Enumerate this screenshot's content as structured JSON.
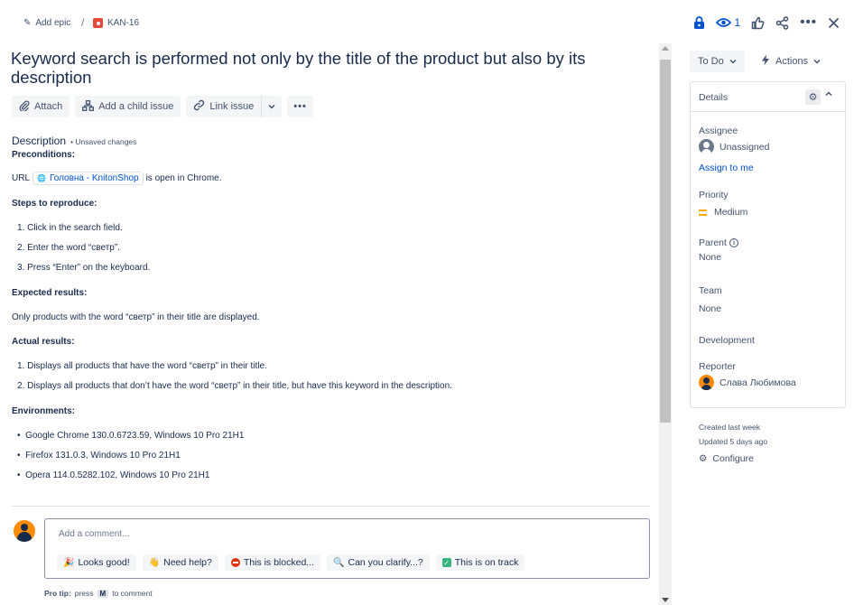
{
  "breadcrumb": {
    "epic_label": "Add epic",
    "separator": "/",
    "issue_key": "KAN-16"
  },
  "header": {
    "watch_count": "1"
  },
  "issue": {
    "title": "Keyword search is performed not only by the title of the product but also by its description"
  },
  "toolbar": {
    "attach": "Attach",
    "child": "Add a child issue",
    "link": "Link issue"
  },
  "description": {
    "heading": "Description",
    "unsaved": "• Unsaved changes",
    "preconditions_h": "Preconditions:",
    "url_prefix": "URL",
    "url_link": "Головна - KnitonShop",
    "url_suffix": "is open in Chrome.",
    "steps_h": "Steps to reproduce:",
    "steps": [
      "1. Click in the search field.",
      "2. Enter the word “светр”.",
      "3. Press “Enter” on the keyboard."
    ],
    "expected_h": "Expected results:",
    "expected": "Only products with the word “светр” in their title are displayed.",
    "actual_h": "Actual results:",
    "actual": [
      "1. Displays all products that have the word “светр” in their title.",
      "2. Displays all products that don’t have the word “светр” in their title, but have this keyword in the description."
    ],
    "env_h": "Environments:",
    "env": [
      "Google Chrome 130.0.6723.59, Windows 10 Pro 21H1",
      "Firefox 131.0.3, Windows 10 Pro 21H1",
      "Opera 114.0.5282.102, Windows 10 Pro 21H1"
    ]
  },
  "comment": {
    "placeholder": "Add a comment...",
    "chips": [
      "Looks good!",
      "Need help?",
      "This is blocked...",
      "Can you clarify...?",
      "This is on track"
    ],
    "protip_bold": "Pro tip:",
    "protip_press": "press",
    "protip_key": "M",
    "protip_rest": "to comment"
  },
  "sidebar": {
    "status": "To Do",
    "actions": "Actions",
    "details_title": "Details",
    "assignee_label": "Assignee",
    "assignee_value": "Unassigned",
    "assign_me": "Assign to me",
    "priority_label": "Priority",
    "priority_value": "Medium",
    "parent_label": "Parent",
    "parent_value": "None",
    "team_label": "Team",
    "team_value": "None",
    "development_label": "Development",
    "reporter_label": "Reporter",
    "reporter_value": "Слава Любимова",
    "created": "Created last week",
    "updated": "Updated 5 days ago",
    "configure": "Configure"
  },
  "colors": {
    "accent": "#0052cc",
    "bug": "#e5493a",
    "priority_medium": "#ffab00",
    "avatar": "#ff8b00"
  }
}
